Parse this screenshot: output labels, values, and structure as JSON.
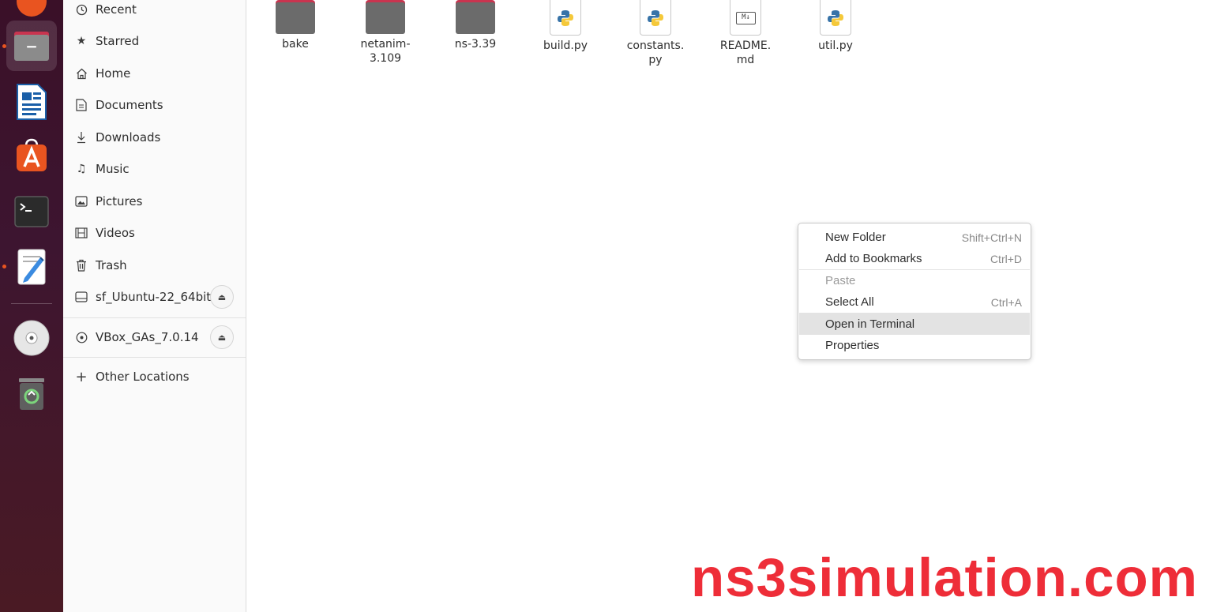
{
  "colors": {
    "dock_bg": "#3d1530",
    "accent": "#e95420",
    "folder_tab": "#c9344f",
    "folder_body": "#6b6b6b",
    "watermark": "#ee2d38"
  },
  "dock": {
    "apps": [
      {
        "name": "files",
        "icon": "files-icon"
      },
      {
        "name": "writer",
        "icon": "writer-icon"
      },
      {
        "name": "app-center",
        "icon": "app-store-icon"
      },
      {
        "name": "terminal",
        "icon": "terminal-icon"
      },
      {
        "name": "text-editor",
        "icon": "text-editor-icon"
      },
      {
        "name": "optical-drive",
        "icon": "disc-icon"
      },
      {
        "name": "trash",
        "icon": "trash-icon"
      }
    ]
  },
  "sidebar": {
    "items": [
      {
        "label": "Recent",
        "icon": "clock-icon"
      },
      {
        "label": "Starred",
        "icon": "star-icon"
      },
      {
        "label": "Home",
        "icon": "home-icon"
      },
      {
        "label": "Documents",
        "icon": "document-icon"
      },
      {
        "label": "Downloads",
        "icon": "download-icon"
      },
      {
        "label": "Music",
        "icon": "music-icon"
      },
      {
        "label": "Pictures",
        "icon": "picture-icon"
      },
      {
        "label": "Videos",
        "icon": "video-icon"
      },
      {
        "label": "Trash",
        "icon": "trash-icon"
      },
      {
        "label": "sf_Ubuntu-22_64bit",
        "icon": "drive-icon"
      },
      {
        "label": "VBox_GAs_7.0.14",
        "icon": "disc-icon"
      },
      {
        "label": "Other Locations",
        "icon": "plus-icon"
      }
    ]
  },
  "files": [
    {
      "line1": "bake",
      "line2": "",
      "type": "folder"
    },
    {
      "line1": "netanim-",
      "line2": "3.109",
      "type": "folder"
    },
    {
      "line1": "ns-3.39",
      "line2": "",
      "type": "folder"
    },
    {
      "line1": "build.py",
      "line2": "",
      "type": "python"
    },
    {
      "line1": "constants.",
      "line2": "py",
      "type": "python"
    },
    {
      "line1": "README.",
      "line2": "md",
      "type": "markdown"
    },
    {
      "line1": "util.py",
      "line2": "",
      "type": "python"
    }
  ],
  "context_menu": {
    "items": [
      {
        "label": "New Folder",
        "shortcut": "Shift+Ctrl+N"
      },
      {
        "label": "Add to Bookmarks",
        "shortcut": "Ctrl+D"
      },
      {
        "label": "Paste",
        "shortcut": "",
        "disabled": true
      },
      {
        "label": "Select All",
        "shortcut": "Ctrl+A"
      },
      {
        "label": "Open in Terminal",
        "shortcut": "",
        "highlighted": true
      },
      {
        "label": "Properties",
        "shortcut": ""
      }
    ]
  },
  "markdown_badge": "M↓",
  "watermark": "ns3simulation.com"
}
